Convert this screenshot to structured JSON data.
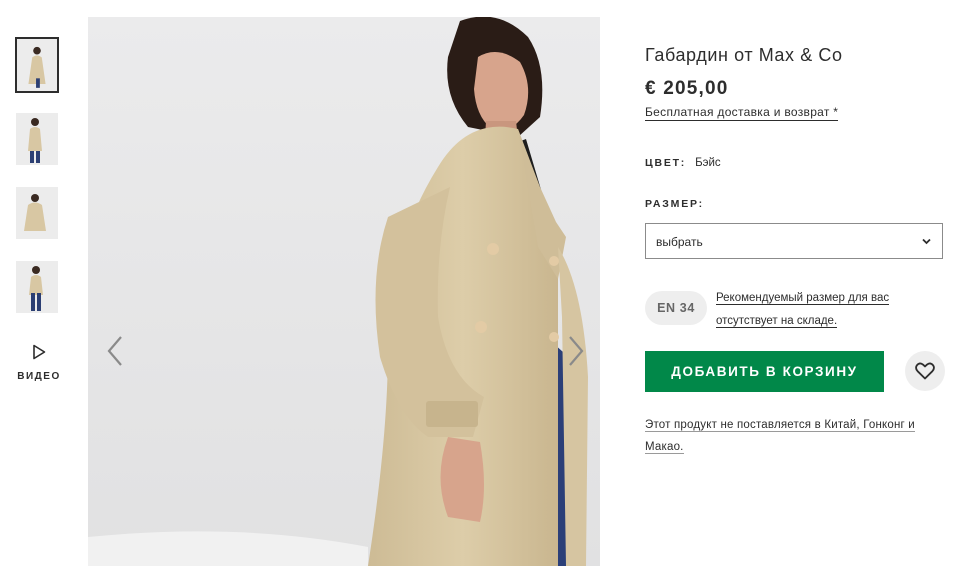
{
  "product": {
    "title": "Габардин от Max & Co",
    "price": "€ 205,00",
    "delivery_link": "Бесплатная доставка и возврат *",
    "color_label": "ЦВЕТ:",
    "color_value": "Бэйс",
    "size_label": "РАЗМЕР:",
    "size_select": "выбрать",
    "size_badge": "EN 34",
    "recommended_line1": "Рекомендуемый размер для вас",
    "recommended_line2": "отсутствует на складе.",
    "add_to_cart": "ДОБАВИТЬ В КОРЗИНУ",
    "shipping_notice_line1": "Этот продукт не поставляется в Китай, Гонконг и",
    "shipping_notice_line2": "Макао."
  },
  "gallery": {
    "video_label": "ВИДЕО",
    "thumbnails": [
      "thumb-1",
      "thumb-2",
      "thumb-3",
      "thumb-4"
    ],
    "active_thumbnail": 1
  },
  "colors": {
    "accent_green": "#018849",
    "text": "#2d2d2d",
    "coat": "#d8c7a3",
    "image_bg": "#e9e9ea"
  },
  "icons": {
    "prev": "chevron-left-icon",
    "next": "chevron-right-icon",
    "play": "play-icon",
    "select": "chevron-down-icon",
    "wishlist": "heart-icon"
  }
}
